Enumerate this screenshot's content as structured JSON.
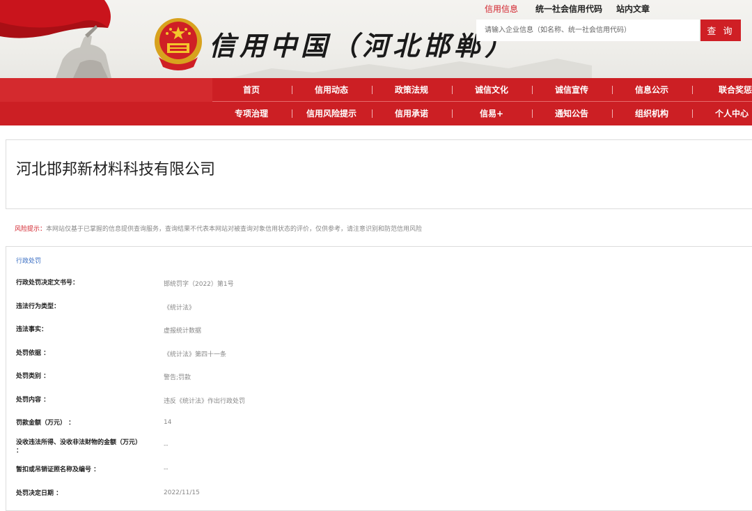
{
  "header": {
    "site_title": "信用中国（河北邯郸）",
    "top_links": [
      "信用信息",
      "统一社会信用代码",
      "站内文章"
    ],
    "search_placeholder": "请输入企业信息（如名称、统一社会信用代码）",
    "search_button": "查 询"
  },
  "nav": {
    "row1": [
      "首页",
      "信用动态",
      "政策法规",
      "诚信文化",
      "诚信宣传",
      "信息公示",
      "联合奖惩"
    ],
    "row2": [
      "专项治理",
      "信用风险提示",
      "信用承诺",
      "信易+",
      "通知公告",
      "组织机构",
      "个人中心"
    ]
  },
  "company": {
    "name": "河北邯邦新材料科技有限公司"
  },
  "risk": {
    "label": "风险提示：",
    "text": "本网站仅基于已掌握的信息提供查询服务，查询结果不代表本网站对被查询对象信用状态的评价，仅供参考，请注意识别和防范信用风险"
  },
  "penalty": {
    "section_title": "行政处罚",
    "rows": [
      {
        "label": "行政处罚决定文书号：",
        "value": "邯统罚字（2022）第1号"
      },
      {
        "label": "违法行为类型：",
        "value": "《统计法》"
      },
      {
        "label": "违法事实：",
        "value": "虚报统计数据"
      },
      {
        "label": "处罚依据 ：",
        "value": "《统计法》第四十一条"
      },
      {
        "label": "处罚类别 ：",
        "value": "警告;罚款"
      },
      {
        "label": "处罚内容 ：",
        "value": "违反《统计法》作出行政处罚"
      },
      {
        "label": "罚款金额（万元） ：",
        "value": "14"
      },
      {
        "label": "没收违法所得、没收非法财物的金额（万元） ：",
        "value": "--"
      },
      {
        "label": "暂扣或吊销证照名称及编号 ：",
        "value": "--"
      },
      {
        "label": "处罚决定日期 ：",
        "value": "2022/11/15"
      }
    ]
  },
  "colors": {
    "brand_red": "#cc1f24",
    "link_blue": "#3a6ec3"
  },
  "icons": [
    "national-emblem-icon",
    "red-flag-decoration",
    "horse-rider-decoration"
  ]
}
